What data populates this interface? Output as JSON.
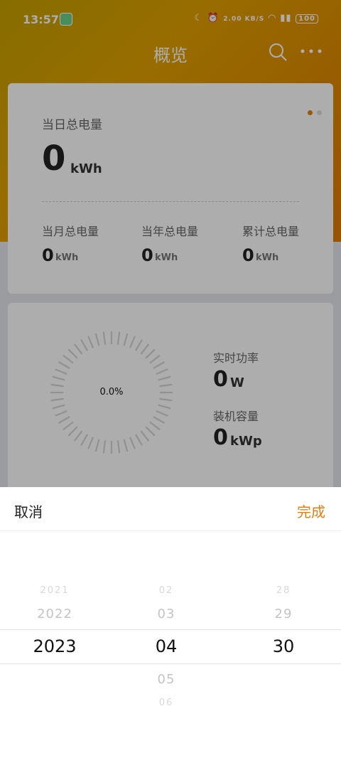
{
  "status_bar": {
    "time": "13:57",
    "net_speed": "2.00 KB/S",
    "battery": "100"
  },
  "header": {
    "title": "概览"
  },
  "energy_card": {
    "daily_label": "当日总电量",
    "daily_value": "0",
    "daily_unit": "kWh",
    "monthly_label": "当月总电量",
    "monthly_value": "0",
    "monthly_unit": "kWh",
    "yearly_label": "当年总电量",
    "yearly_value": "0",
    "yearly_unit": "kWh",
    "total_label": "累计总电量",
    "total_value": "0",
    "total_unit": "kWh"
  },
  "power_card": {
    "gauge_percent_text": "0.0%",
    "gauge_fraction": 0.0,
    "realtime_label": "实时功率",
    "realtime_value": "0",
    "realtime_unit": "W",
    "capacity_label": "装机容量",
    "capacity_value": "0",
    "capacity_unit": "kWp"
  },
  "picker": {
    "cancel_label": "取消",
    "done_label": "完成",
    "years": [
      "2021",
      "2022",
      "2023"
    ],
    "months": [
      "02",
      "03",
      "04",
      "05",
      "06"
    ],
    "days": [
      "28",
      "29",
      "30"
    ],
    "selected": {
      "year": "2023",
      "month": "04",
      "day": "30"
    }
  },
  "colors": {
    "accent": "#e08010",
    "header_gradient_start": "#c7a100",
    "header_gradient_end": "#e07a05"
  }
}
